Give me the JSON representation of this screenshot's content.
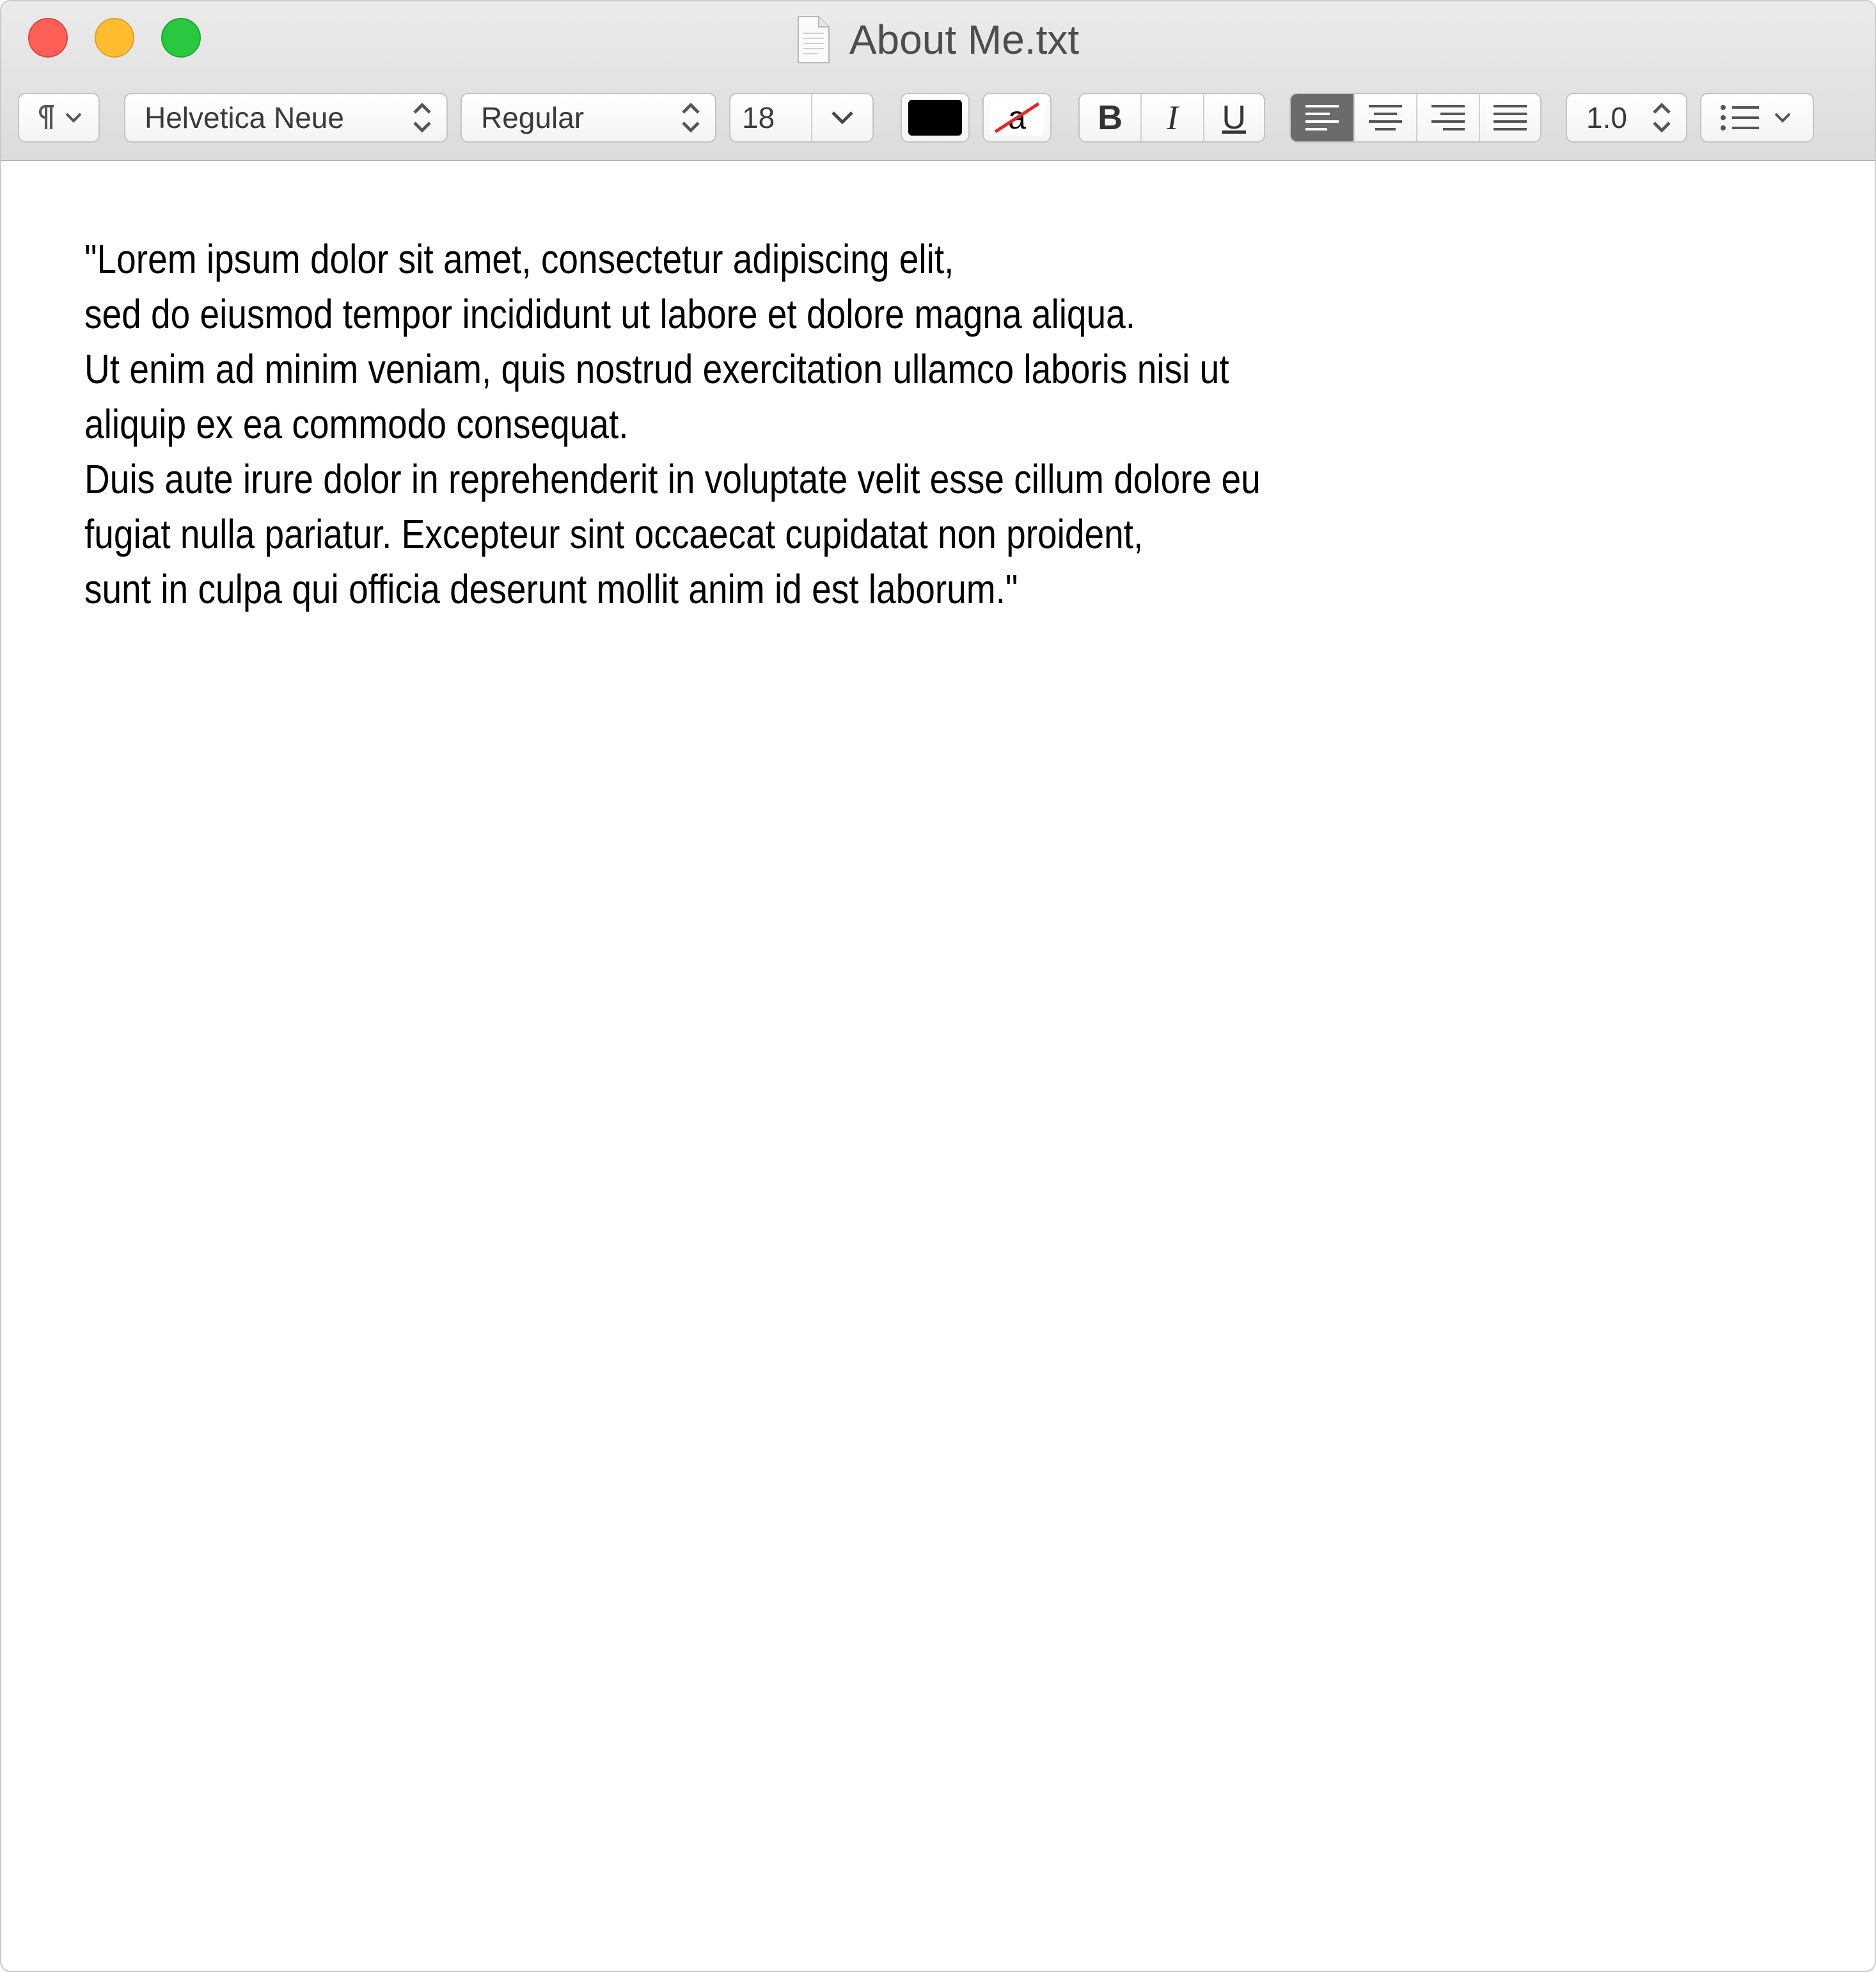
{
  "window": {
    "title": "About Me.txt"
  },
  "toolbar": {
    "paragraph_style_icon": "pilcrow-icon",
    "font_family": "Helvetica Neue",
    "font_style": "Regular",
    "font_size": "18",
    "text_color": "#000000",
    "highlight_glyph": "a",
    "bold_label": "B",
    "italic_label": "I",
    "underline_label": "U",
    "alignment_active": "left",
    "line_spacing": "1.0"
  },
  "document": {
    "lines": [
      "\"Lorem ipsum dolor sit amet, consectetur adipiscing elit,",
      "sed do eiusmod tempor incididunt ut labore et dolore magna aliqua.",
      "Ut enim ad minim veniam, quis nostrud exercitation ullamco laboris nisi ut",
      "aliquip ex ea commodo consequat.",
      "Duis aute irure dolor in reprehenderit in voluptate velit esse cillum dolore eu",
      "fugiat nulla pariatur. Excepteur sint occaecat cupidatat non proident,",
      "sunt in culpa qui officia deserunt mollit anim id est laborum.\""
    ]
  }
}
